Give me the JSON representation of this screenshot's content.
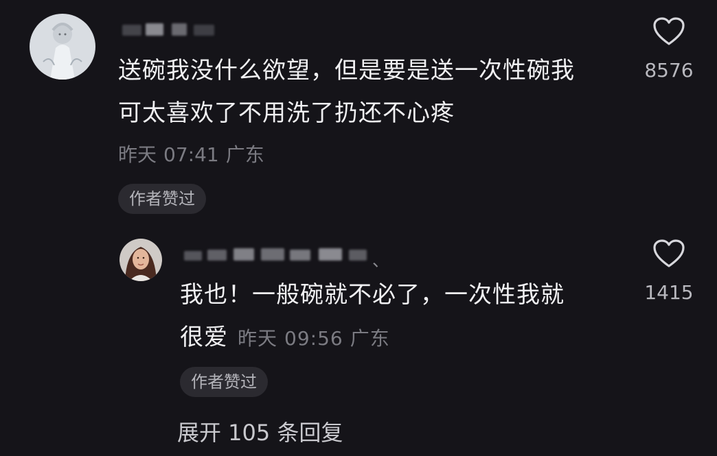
{
  "comment": {
    "username": "",
    "text_line1": "送碗我没什么欲望，但是要是送一次性碗我",
    "text_line2": "可太喜欢了不用洗了扔还不心疼",
    "date": "昨天",
    "time": "07:41",
    "location": "广东",
    "author_badge": "作者赞过",
    "like_count": "8576",
    "like_icon": "heart-outline-icon"
  },
  "reply": {
    "username": "",
    "text_line1": "我也！一般碗就不必了，一次性我就",
    "text_line2": "很爱",
    "date": "昨天",
    "time": "09:56",
    "location": "广东",
    "author_badge": "作者赞过",
    "like_count": "1415",
    "like_icon": "heart-outline-icon"
  },
  "expand_replies": "展开 105 条回复",
  "colors": {
    "background": "#151419",
    "text_primary": "#f0f0f2",
    "text_meta": "#7b7b82",
    "badge_bg": "#2b2a30"
  }
}
